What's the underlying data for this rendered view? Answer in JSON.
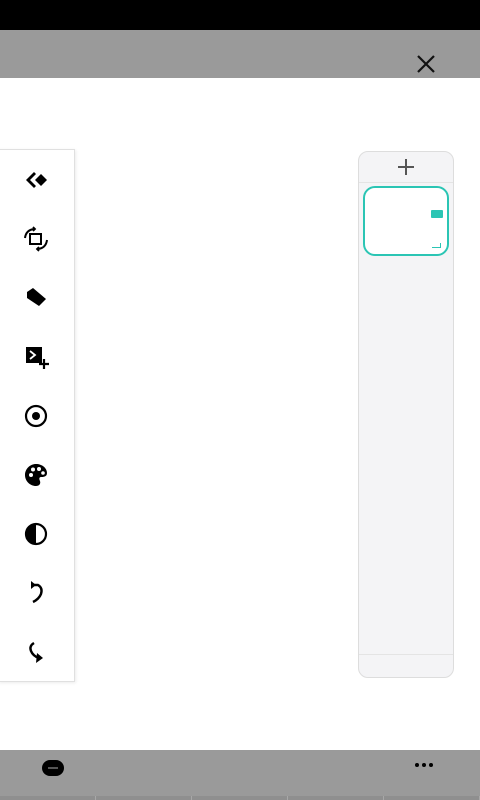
{
  "header": {
    "close_icon": "close-icon"
  },
  "tools": [
    {
      "name": "eraser-tool",
      "icon": "eraser-icon"
    },
    {
      "name": "transform-tool",
      "icon": "transform-icon"
    },
    {
      "name": "fill-tool",
      "icon": "tag-icon"
    },
    {
      "name": "add-media-tool",
      "icon": "add-image-icon"
    },
    {
      "name": "view-tool",
      "icon": "eye-icon"
    },
    {
      "name": "palette-tool",
      "icon": "palette-icon"
    },
    {
      "name": "contrast-tool",
      "icon": "contrast-icon"
    },
    {
      "name": "undo-tool",
      "icon": "undo-icon"
    },
    {
      "name": "redo-tool",
      "icon": "redo-icon"
    }
  ],
  "layers": {
    "add_icon": "plus-icon",
    "selected_color": "#2bc5b4"
  },
  "footer": {
    "left_icon": "toggle-icon",
    "more_icon": "more-icon"
  }
}
